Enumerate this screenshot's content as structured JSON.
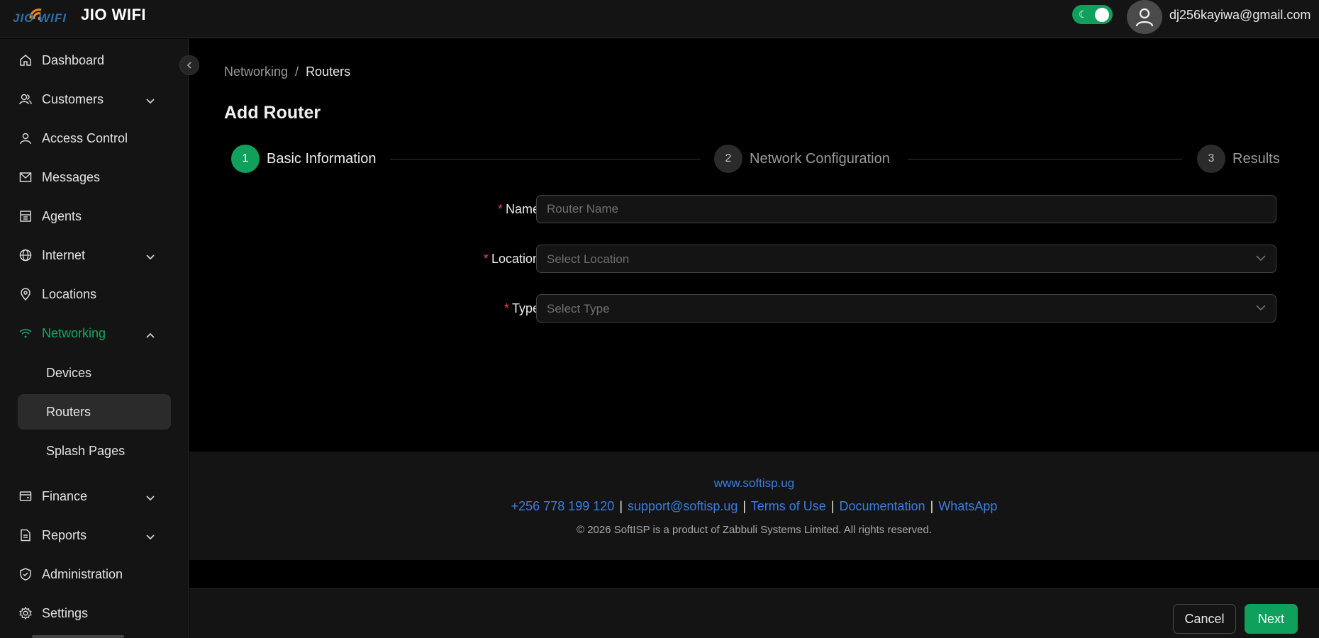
{
  "app": {
    "logo_text": "JIO WIFI",
    "title": "JIO WIFI"
  },
  "header": {
    "theme_toggle_icon": "moon-icon",
    "theme_dark": true,
    "user_email": "dj256kayiwa@gmail.com"
  },
  "sidebar": {
    "items": [
      {
        "label": "Dashboard",
        "icon": "home-icon"
      },
      {
        "label": "Customers",
        "icon": "customers-icon",
        "expandable": true
      },
      {
        "label": "Access Control",
        "icon": "user-icon"
      },
      {
        "label": "Messages",
        "icon": "mail-icon"
      },
      {
        "label": "Agents",
        "icon": "agents-icon"
      },
      {
        "label": "Internet",
        "icon": "globe-icon",
        "expandable": true
      },
      {
        "label": "Locations",
        "icon": "location-pin-icon"
      },
      {
        "label": "Networking",
        "icon": "wifi-icon",
        "expandable": true,
        "expanded": true,
        "active": true
      },
      {
        "label": "Finance",
        "icon": "wallet-icon",
        "expandable": true
      },
      {
        "label": "Reports",
        "icon": "report-icon",
        "expandable": true
      },
      {
        "label": "Administration",
        "icon": "shield-icon"
      },
      {
        "label": "Settings",
        "icon": "gear-icon"
      }
    ],
    "networking_children": [
      {
        "label": "Devices"
      },
      {
        "label": "Routers",
        "selected": true
      },
      {
        "label": "Splash Pages"
      }
    ]
  },
  "breadcrumb": {
    "parent": "Networking",
    "separator": "/",
    "current": "Routers"
  },
  "page": {
    "title": "Add Router"
  },
  "steps": [
    {
      "number": "1",
      "label": "Basic Information",
      "status": "active"
    },
    {
      "number": "2",
      "label": "Network Configuration",
      "status": "pending"
    },
    {
      "number": "3",
      "label": "Results",
      "status": "pending"
    }
  ],
  "form": {
    "name": {
      "label": "Name",
      "required_mark": "*",
      "placeholder": "Router Name",
      "value": ""
    },
    "location": {
      "label": "Location",
      "required_mark": "*",
      "placeholder": "Select Location"
    },
    "type": {
      "label": "Type",
      "required_mark": "*",
      "placeholder": "Select Type"
    }
  },
  "footer": {
    "website": "www.softisp.ug",
    "phone": "+256 778 199 120",
    "email": "support@softisp.ug",
    "terms": "Terms of Use",
    "docs": "Documentation",
    "whatsapp": "WhatsApp",
    "separator": "|",
    "copyright": "© 2026 SoftISP is a product of Zabbuli Systems Limited. All rights reserved."
  },
  "actions": {
    "cancel": "Cancel",
    "next": "Next"
  },
  "colors": {
    "accent": "#0fa15c",
    "link": "#3b7de0",
    "required": "#e04848"
  }
}
